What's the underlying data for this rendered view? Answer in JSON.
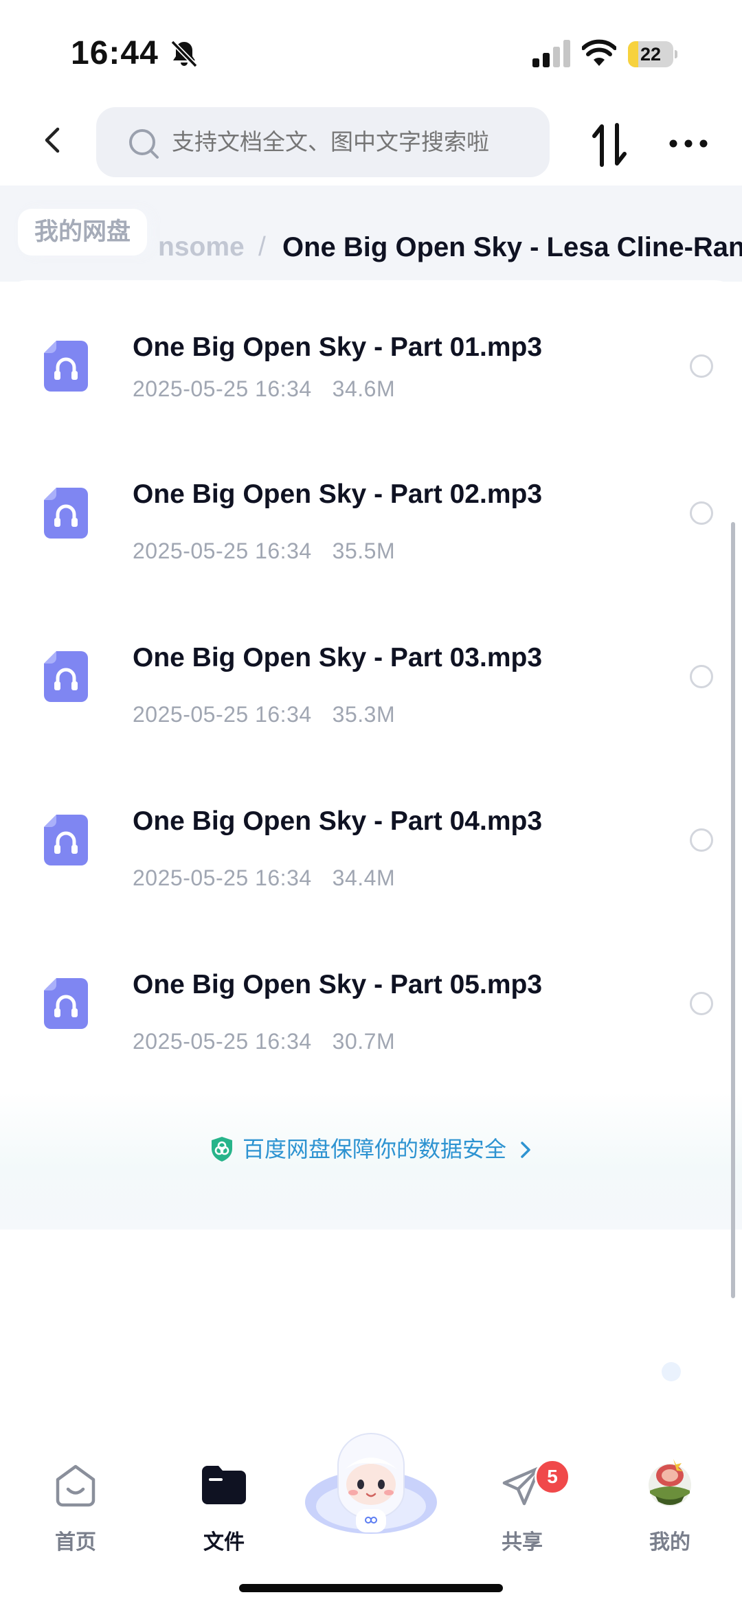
{
  "status_bar": {
    "time": "16:44",
    "battery": "22",
    "battery_level": 0.22,
    "signal_bars": 2
  },
  "header": {
    "search_placeholder": "支持文档全文、图中文字搜索啦"
  },
  "breadcrumb": {
    "root": "我的网盘",
    "previous": "nsome",
    "separator": "/",
    "current": "One Big Open Sky - Lesa Cline-Ran"
  },
  "files": [
    {
      "name": "One Big Open Sky - Part 01.mp3",
      "date": "2025-05-25 16:34",
      "size": "34.6M",
      "icon": "audio-file-icon"
    },
    {
      "name": "One Big Open Sky - Part 02.mp3",
      "date": "2025-05-25 16:34",
      "size": "35.5M",
      "icon": "audio-file-icon"
    },
    {
      "name": "One Big Open Sky - Part 03.mp3",
      "date": "2025-05-25 16:34",
      "size": "35.3M",
      "icon": "audio-file-icon"
    },
    {
      "name": "One Big Open Sky - Part 04.mp3",
      "date": "2025-05-25 16:34",
      "size": "34.4M",
      "icon": "audio-file-icon"
    },
    {
      "name": "One Big Open Sky - Part 05.mp3",
      "date": "2025-05-25 16:34",
      "size": "30.7M",
      "icon": "audio-file-icon"
    }
  ],
  "security_notice": "百度网盘保障你的数据安全",
  "tab_bar": {
    "tabs": [
      {
        "label": "首页",
        "icon": "home-icon"
      },
      {
        "label": "文件",
        "icon": "folder-icon",
        "active": true
      },
      {
        "label": "",
        "icon": "mascot-assistant-icon"
      },
      {
        "label": "共享",
        "icon": "share-icon",
        "badge": "5"
      },
      {
        "label": "我的",
        "icon": "avatar"
      }
    ]
  },
  "colors": {
    "accent": "#2d93d1",
    "file_icon": "#7f86f2",
    "badge": "#f0494a",
    "battery_fill": "#f7d23e"
  }
}
